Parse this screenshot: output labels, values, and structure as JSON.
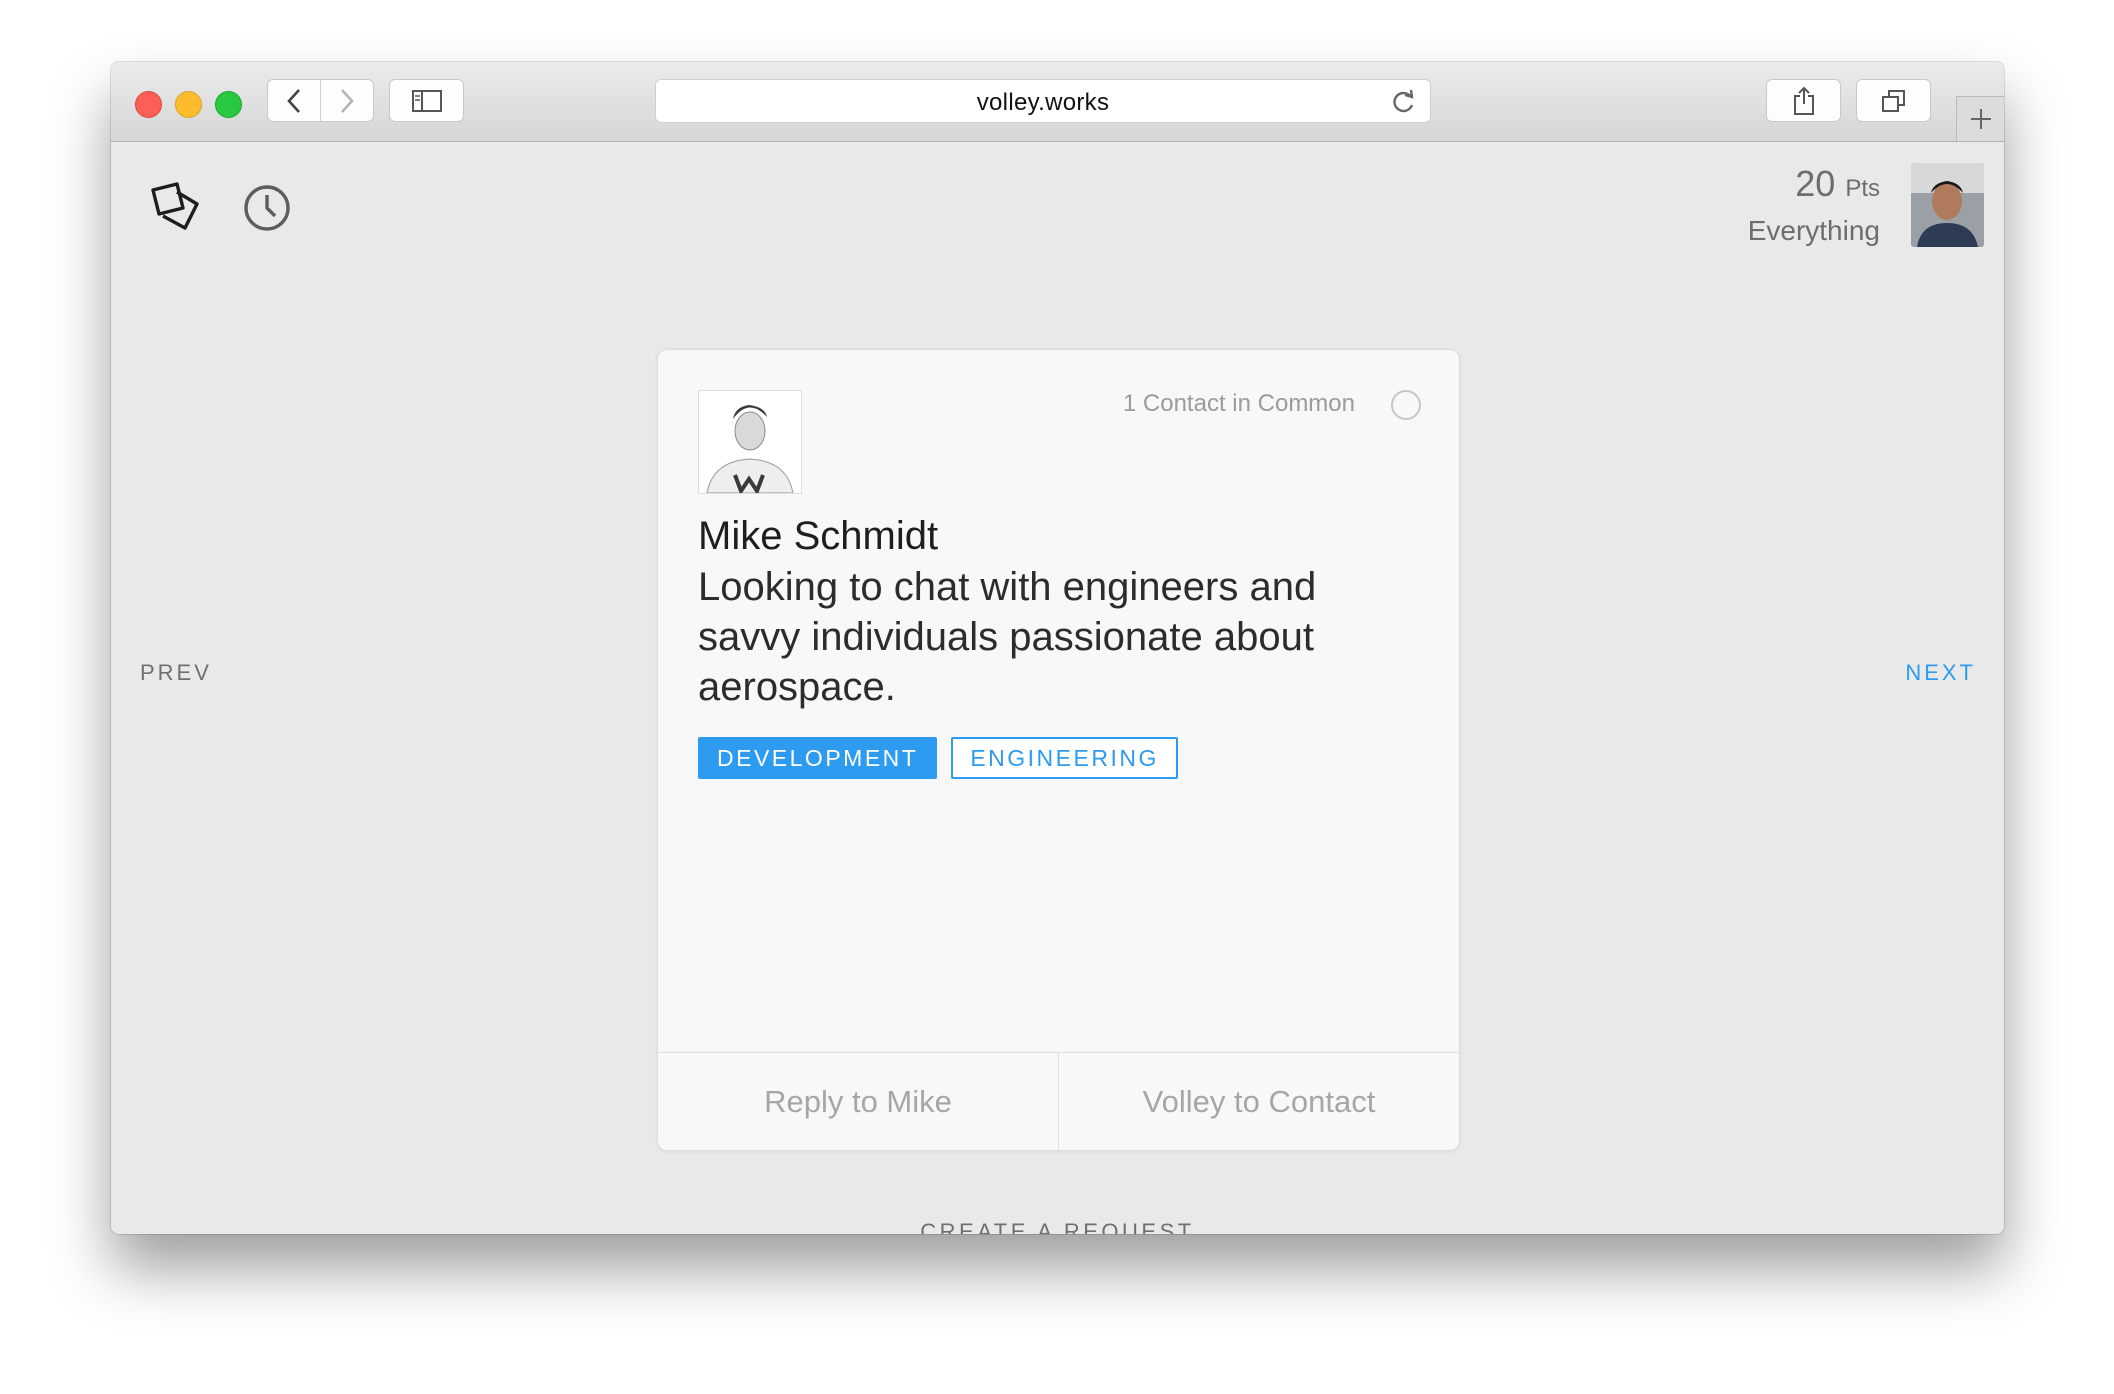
{
  "browser": {
    "url": "volley.works"
  },
  "header": {
    "points_value": "20",
    "points_unit": "Pts",
    "filter_label": "Everything"
  },
  "navigation": {
    "prev_label": "PREV",
    "next_label": "NEXT"
  },
  "card": {
    "contacts_in_common": "1 Contact in Common",
    "name": "Mike Schmidt",
    "request": "Looking to chat with engineers and savvy individuals passionate about aerospace.",
    "tags": [
      "DEVELOPMENT",
      "ENGINEERING"
    ],
    "reply_label": "Reply to Mike",
    "volley_label": "Volley to Contact"
  },
  "footer": {
    "create_label": "CREATE A REQUEST"
  },
  "icons": {
    "home": "cards-icon",
    "history": "clock-icon",
    "reload": "reload-icon",
    "share": "share-icon",
    "tabs": "tabs-icon",
    "sidebar": "sidebar-icon"
  },
  "colors": {
    "accent": "#2d9bf0",
    "background": "#e9e9e9",
    "card": "#f8f8f8"
  }
}
